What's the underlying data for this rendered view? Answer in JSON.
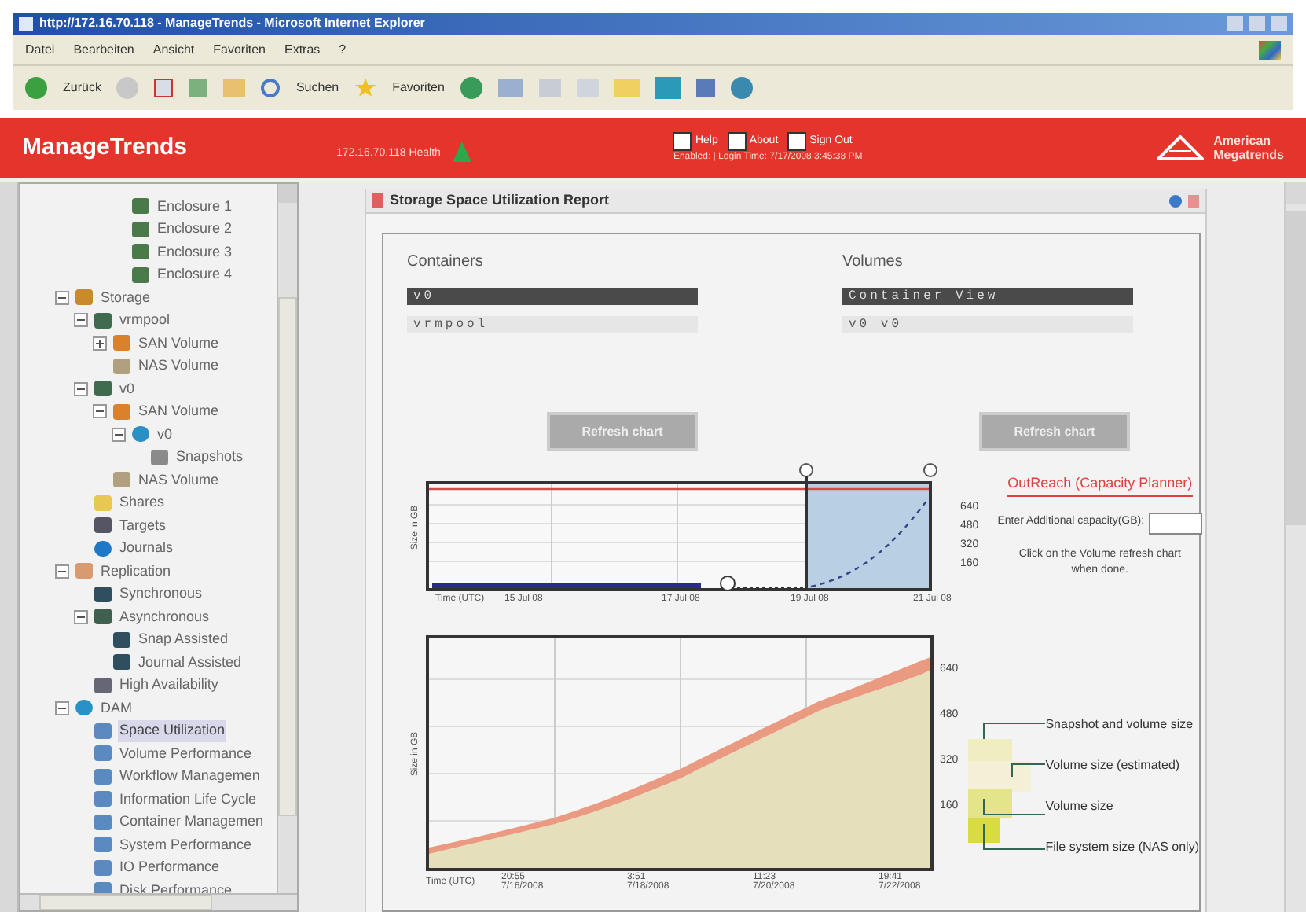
{
  "window": {
    "title": "http://172.16.70.118 - ManageTrends - Microsoft Internet Explorer"
  },
  "menu": [
    "Datei",
    "Bearbeiten",
    "Ansicht",
    "Favoriten",
    "Extras",
    "?"
  ],
  "toolbar": {
    "back": "Zurück",
    "search": "Suchen",
    "favorites": "Favoriten"
  },
  "header": {
    "app_name": "ManageTrends",
    "health": "172.16.70.118 Health",
    "links": [
      "Help",
      "About",
      "Sign Out"
    ],
    "login_info": "Enabled: | Login Time: 7/17/2008 3:45:38 PM",
    "brand": [
      "American",
      "Megatrends"
    ]
  },
  "tree": {
    "cut_off_children": [
      {
        "label": "Enclosure 1",
        "kind": "enclosure",
        "selected": false
      },
      {
        "label": "Enclosure 2",
        "kind": "enclosure",
        "selected": false
      },
      {
        "label": "Enclosure 3",
        "kind": "enclosure",
        "selected": false
      },
      {
        "label": "Enclosure 4",
        "kind": "enclosure",
        "selected": false
      }
    ],
    "items": [
      {
        "label": "Storage",
        "kind": "storage",
        "selected": false,
        "expanded": true,
        "children": [
          {
            "label": "vrmpool",
            "kind": "pool",
            "selected": false,
            "expanded": true,
            "children": [
              {
                "label": "SAN Volume",
                "kind": "san",
                "selected": false,
                "expanded": false
              },
              {
                "label": "NAS Volume",
                "kind": "nas",
                "selected": false
              }
            ]
          },
          {
            "label": "v0",
            "kind": "pool",
            "selected": false,
            "expanded": true,
            "children": [
              {
                "label": "SAN Volume",
                "kind": "san",
                "selected": false,
                "expanded": true,
                "children": [
                  {
                    "label": "v0",
                    "kind": "volume",
                    "selected": false,
                    "expanded": true,
                    "children": [
                      {
                        "label": "Snapshots",
                        "kind": "snapshots",
                        "selected": false
                      }
                    ]
                  }
                ]
              },
              {
                "label": "NAS Volume",
                "kind": "nas",
                "selected": false
              }
            ]
          },
          {
            "label": "Shares",
            "kind": "shares",
            "selected": false
          },
          {
            "label": "Targets",
            "kind": "targets",
            "selected": false
          },
          {
            "label": "Journals",
            "kind": "journals",
            "selected": false
          }
        ]
      },
      {
        "label": "Replication",
        "kind": "replication",
        "selected": false,
        "expanded": true,
        "children": [
          {
            "label": "Synchronous",
            "kind": "sync",
            "selected": false
          },
          {
            "label": "Asynchronous",
            "kind": "async",
            "selected": false,
            "expanded": true,
            "children": [
              {
                "label": "Snap Assisted",
                "kind": "sync",
                "selected": false
              },
              {
                "label": "Journal Assisted",
                "kind": "sync",
                "selected": false
              }
            ]
          },
          {
            "label": "High Availability",
            "kind": "ha",
            "selected": false
          }
        ]
      },
      {
        "label": "DAM",
        "kind": "dam",
        "selected": false,
        "expanded": true,
        "children": [
          {
            "label": "Space Utilization",
            "kind": "report",
            "selected": true
          },
          {
            "label": "Volume Performance",
            "kind": "report",
            "selected": false
          },
          {
            "label": "Workflow Managemen",
            "kind": "report",
            "selected": false
          },
          {
            "label": "Information Life Cycle",
            "kind": "report",
            "selected": false
          },
          {
            "label": "Container Managemen",
            "kind": "report",
            "selected": false
          },
          {
            "label": "System Performance",
            "kind": "report",
            "selected": false
          },
          {
            "label": "IO Performance",
            "kind": "report",
            "selected": false
          },
          {
            "label": "Disk Performance",
            "kind": "report",
            "selected": false
          }
        ]
      }
    ]
  },
  "report": {
    "title": "Storage Space Utilization Report",
    "containers": {
      "label": "Containers",
      "items": [
        {
          "label": "v0",
          "selected": true
        },
        {
          "label": "vrmpool",
          "selected": false
        }
      ]
    },
    "volumes": {
      "label": "Volumes",
      "items": [
        {
          "label": "Container View",
          "selected": true
        },
        {
          "label": "v0 v0",
          "selected": false
        }
      ]
    },
    "refresh_buttons": [
      "Refresh chart",
      "Refresh chart"
    ],
    "outreach": {
      "link": "OutReach (Capacity Planner)",
      "capacity_label": "Enter Additional capacity(GB):",
      "hint": "Click on the Volume refresh chart when done."
    },
    "overview_chart": {
      "ylabel": "Size in GB",
      "yticks": [
        "640",
        "480",
        "320",
        "160"
      ],
      "xlabels": [
        "Time (UTC)",
        "15 Jul 08",
        "17 Jul 08",
        "19 Jul 08",
        "21 Jul 08"
      ]
    },
    "detail_chart": {
      "ylabel": "Size in GB",
      "yticks": [
        "640",
        "480",
        "320",
        "160"
      ],
      "xtitle": "Time (UTC)",
      "xlabels": [
        [
          "20:55",
          "7/16/2008"
        ],
        [
          "3:51",
          "7/18/2008"
        ],
        [
          "11:23",
          "7/20/2008"
        ],
        [
          "19:41",
          "7/22/2008"
        ]
      ],
      "legend": [
        "Snapshot and volume size",
        "Volume size (estimated)",
        "Volume size",
        "File system size (NAS only)"
      ]
    }
  }
}
